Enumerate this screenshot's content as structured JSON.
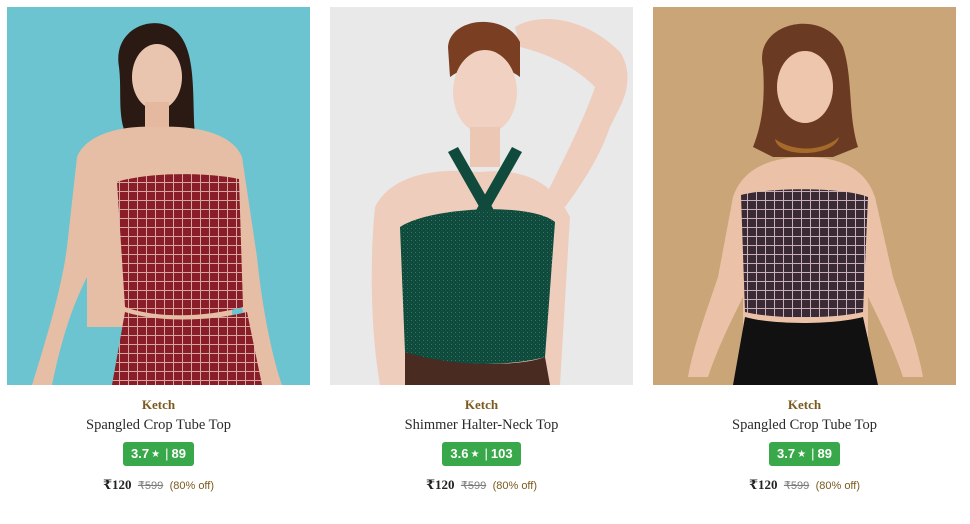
{
  "products": [
    {
      "brand": "Ketch",
      "title": "Spangled Crop Tube Top",
      "rating": "3.7",
      "rating_count": "89",
      "price": "₹120",
      "mrp": "₹599",
      "discount": "(80% off)",
      "image_background": "#6bc4cf",
      "garment_color": "#8a1e28"
    },
    {
      "brand": "Ketch",
      "title": "Shimmer Halter-Neck Top",
      "rating": "3.6",
      "rating_count": "103",
      "price": "₹120",
      "mrp": "₹599",
      "discount": "(80% off)",
      "image_background": "#e9e9ea",
      "garment_color": "#0f4a3c"
    },
    {
      "brand": "Ketch",
      "title": "Spangled Crop Tube Top",
      "rating": "3.7",
      "rating_count": "89",
      "price": "₹120",
      "mrp": "₹599",
      "discount": "(80% off)",
      "image_background": "#c9a577",
      "garment_color": "#3a2a33"
    }
  ],
  "colors": {
    "brand_text": "#7b5a1f",
    "rating_badge": "#38a84a"
  }
}
